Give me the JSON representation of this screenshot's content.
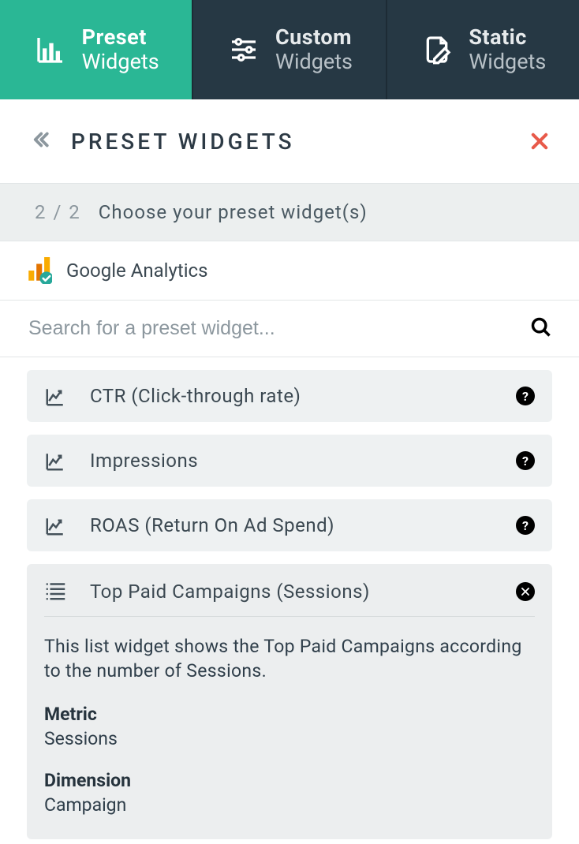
{
  "tabs": [
    {
      "title": "Preset",
      "subtitle": "Widgets",
      "icon": "bar-chart"
    },
    {
      "title": "Custom",
      "subtitle": "Widgets",
      "icon": "sliders"
    },
    {
      "title": "Static",
      "subtitle": "Widgets",
      "icon": "doc-pencil"
    }
  ],
  "panel_title": "PRESET WIDGETS",
  "step": {
    "counter": "2 / 2",
    "text": "Choose your preset widget(s)"
  },
  "source": {
    "name": "Google Analytics"
  },
  "search": {
    "placeholder": "Search for a preset widget..."
  },
  "widgets": [
    {
      "name": "CTR (Click-through rate)",
      "type": "line"
    },
    {
      "name": "Impressions",
      "type": "line"
    },
    {
      "name": "ROAS (Return On Ad Spend)",
      "type": "line"
    }
  ],
  "expanded_widget": {
    "name": "Top Paid Campaigns (Sessions)",
    "description": "This list widget shows the Top Paid Campaigns according to the number of Sessions.",
    "metric_label": "Metric",
    "metric_value": "Sessions",
    "dimension_label": "Dimension",
    "dimension_value": "Campaign"
  }
}
